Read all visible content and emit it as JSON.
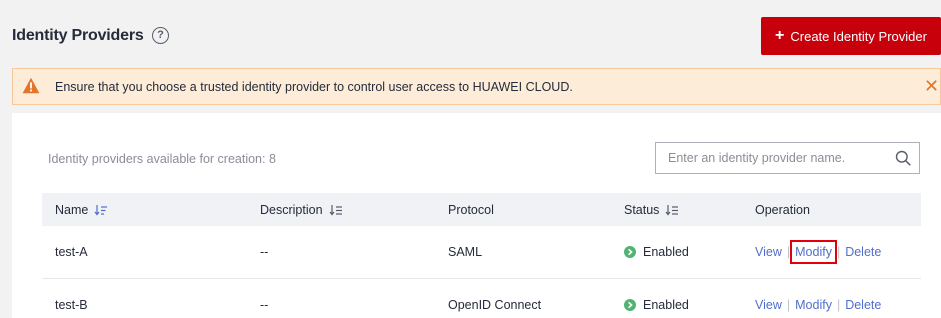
{
  "header": {
    "title": "Identity Providers",
    "help_glyph": "?",
    "create_button_label": "Create Identity Provider",
    "create_button_icon": "+"
  },
  "alert": {
    "text": "Ensure that you choose a trusted identity provider to control user access to HUAWEI CLOUD.",
    "close_glyph": "✕",
    "icon": "warning-icon"
  },
  "panel": {
    "available_text": "Identity providers available for creation: 8",
    "search": {
      "placeholder": "Enter an identity provider name.",
      "value": ""
    }
  },
  "table": {
    "columns": {
      "name": "Name",
      "description": "Description",
      "protocol": "Protocol",
      "status": "Status",
      "operation": "Operation"
    },
    "rows": [
      {
        "name": "test-A",
        "description": "--",
        "protocol": "SAML",
        "status": "Enabled",
        "ops": {
          "view": "View",
          "modify": "Modify",
          "delete": "Delete"
        }
      },
      {
        "name": "test-B",
        "description": "--",
        "protocol": "OpenID Connect",
        "status": "Enabled",
        "ops": {
          "view": "View",
          "modify": "Modify",
          "delete": "Delete"
        }
      }
    ]
  },
  "colors": {
    "primary_red": "#c7000b",
    "link_blue": "#526ecc",
    "enabled_green": "#50b371",
    "warning_orange": "#e2762a",
    "highlight_red": "#e1000b"
  }
}
